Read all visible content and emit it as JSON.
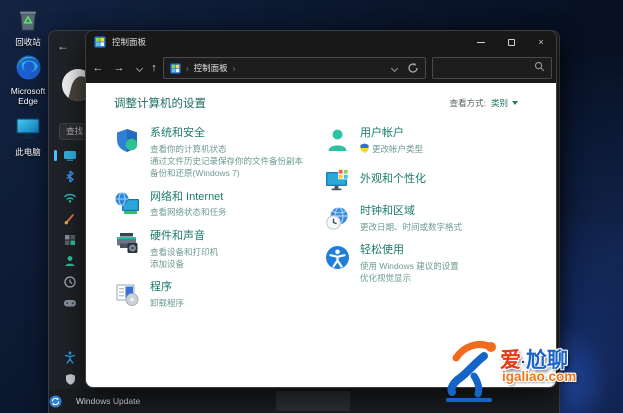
{
  "desktop": {
    "icons": [
      {
        "name": "recycle-bin",
        "label": "回收站"
      },
      {
        "name": "microsoft-edge",
        "label": "Microsoft Edge"
      },
      {
        "name": "this-pc",
        "label": "此电脑"
      }
    ]
  },
  "settings_window": {
    "back_glyph": "←",
    "search_text": "查找",
    "windows_update_label": "Windows Update",
    "sidebar_icons": [
      "display-icon",
      "bluetooth-icon",
      "wifi-icon",
      "personalization-brush-icon",
      "apps-icon",
      "accounts-person-icon",
      "time-clock-icon",
      "gaming-gamepad-icon",
      "accessibility-icon",
      "privacy-shield-icon",
      "windows-update-icon"
    ]
  },
  "control_panel": {
    "window_title": "控制面板",
    "nav": {
      "back": "←",
      "forward": "→",
      "up": "↑"
    },
    "breadcrumb": {
      "path": "控制面板"
    },
    "search_value": "",
    "header": {
      "title": "调整计算机的设置",
      "view_by_label": "查看方式:",
      "view_by_value": "类别"
    },
    "categories": {
      "left": [
        {
          "icon": "security-shield-icon",
          "title": "系统和安全",
          "links": [
            "查看你的计算机状态",
            "通过文件历史记录保存你的文件备份副本",
            "备份和还原(Windows 7)"
          ]
        },
        {
          "icon": "network-globe-monitor-icon",
          "title": "网络和 Internet",
          "links": [
            "查看网络状态和任务"
          ]
        },
        {
          "icon": "printer-speaker-icon",
          "title": "硬件和声音",
          "links": [
            "查看设备和打印机",
            "添加设备"
          ]
        },
        {
          "icon": "program-disc-icon",
          "title": "程序",
          "links": [
            "卸载程序"
          ]
        }
      ],
      "right": [
        {
          "icon": "user-silhouette-icon",
          "title": "用户帐户",
          "links": [
            "更改帐户类型"
          ]
        },
        {
          "icon": "monitor-tiles-icon",
          "title": "外观和个性化",
          "links": []
        },
        {
          "icon": "globe-clock-icon",
          "title": "时钟和区域",
          "links": [
            "更改日期、时间或数字格式"
          ]
        },
        {
          "icon": "accessibility-circle-icon",
          "title": "轻松使用",
          "links": [
            "使用 Windows 建议的设置",
            "优化视觉显示"
          ]
        }
      ]
    }
  },
  "watermark": {
    "brand_part1": "爱",
    "brand_sep": "·",
    "brand_part2": "尬聊",
    "site": "igaliao.com"
  }
}
